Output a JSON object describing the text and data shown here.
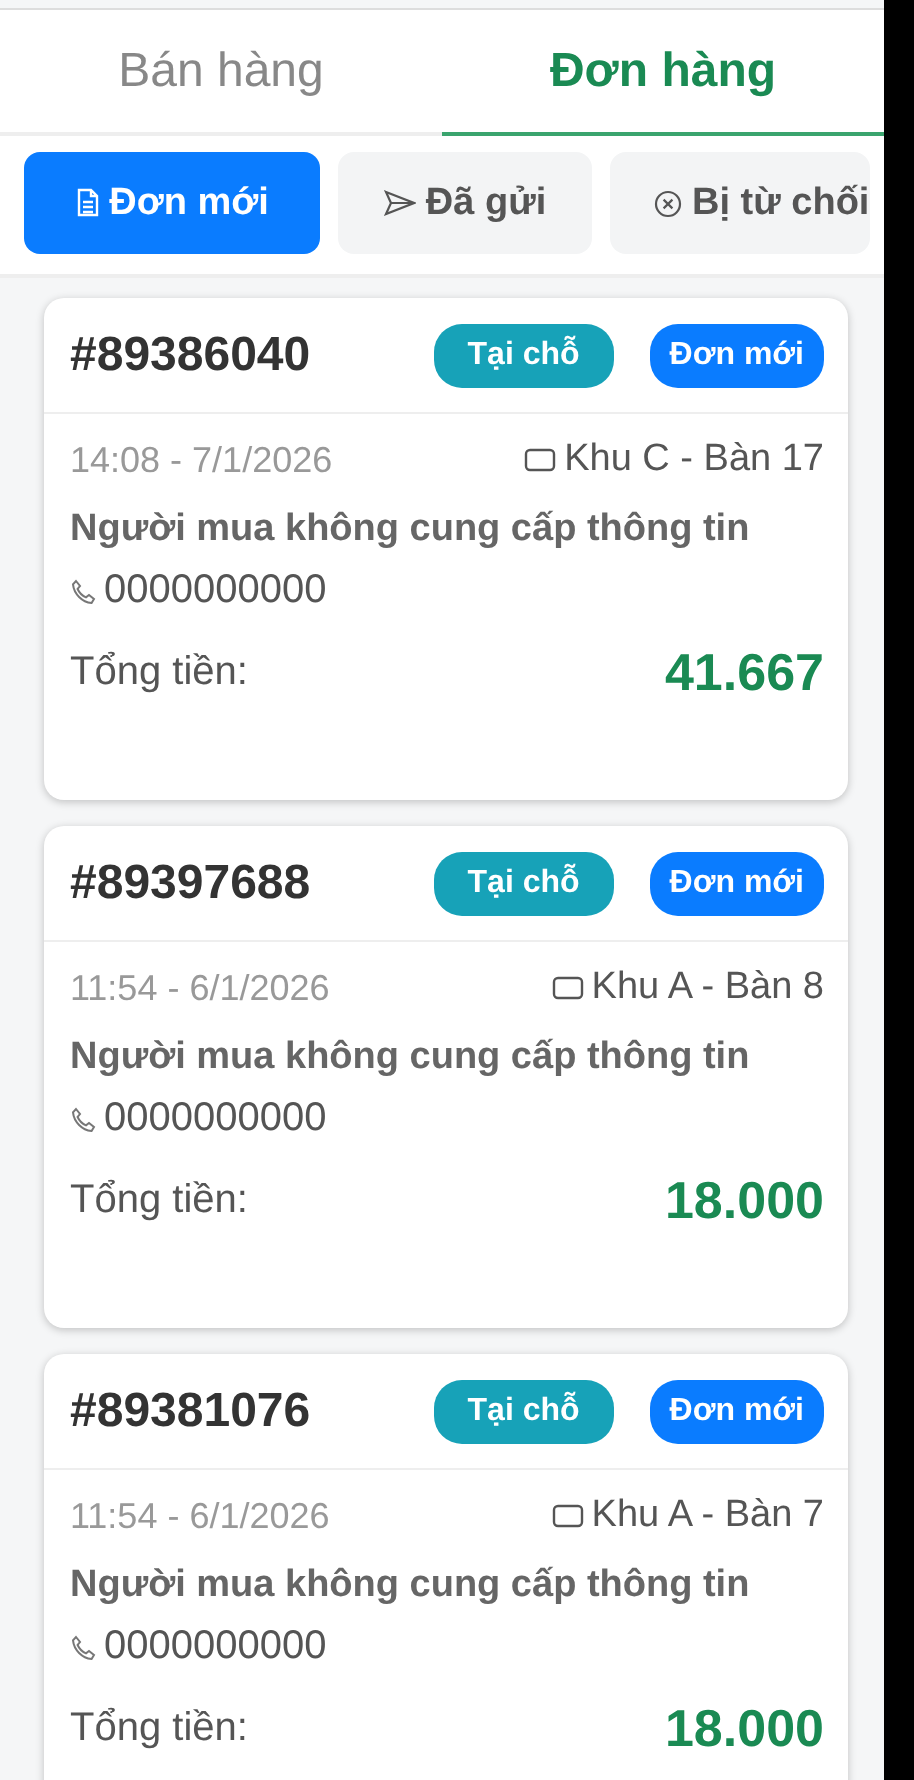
{
  "tabs": [
    {
      "label": "Bán hàng",
      "selected": false
    },
    {
      "label": "Đơn hàng",
      "selected": true
    }
  ],
  "filters": [
    {
      "kind": "document",
      "label": "Đơn mới",
      "selected": true
    },
    {
      "kind": "send",
      "label": "Đã gửi",
      "selected": false
    },
    {
      "kind": "rejected",
      "label": "Bị từ chối",
      "selected": false
    }
  ],
  "orders": [
    {
      "code": "#89386040",
      "type": "Tại chỗ",
      "status": "Đơn mới",
      "time": "14:08 - 7/1/2026",
      "table": "Khu C - Bàn 17",
      "buyer": "Người mua không cung cấp thông tin",
      "phone": "0000000000",
      "total_label": "Tổng tiền:",
      "total": "41.667"
    },
    {
      "code": "#89397688",
      "type": "Tại chỗ",
      "status": "Đơn mới",
      "time": "11:54 - 6/1/2026",
      "table": "Khu A - Bàn 8",
      "buyer": "Người mua không cung cấp thông tin",
      "phone": "0000000000",
      "total_label": "Tổng tiền:",
      "total": "18.000"
    },
    {
      "code": "#89381076",
      "type": "Tại chỗ",
      "status": "Đơn mới",
      "time": "11:54 - 6/1/2026",
      "table": "Khu A - Bàn 7",
      "buyer": "Người mua không cung cấp thông tin",
      "phone": "0000000000",
      "total_label": "Tổng tiền:",
      "total": "18.000"
    }
  ]
}
